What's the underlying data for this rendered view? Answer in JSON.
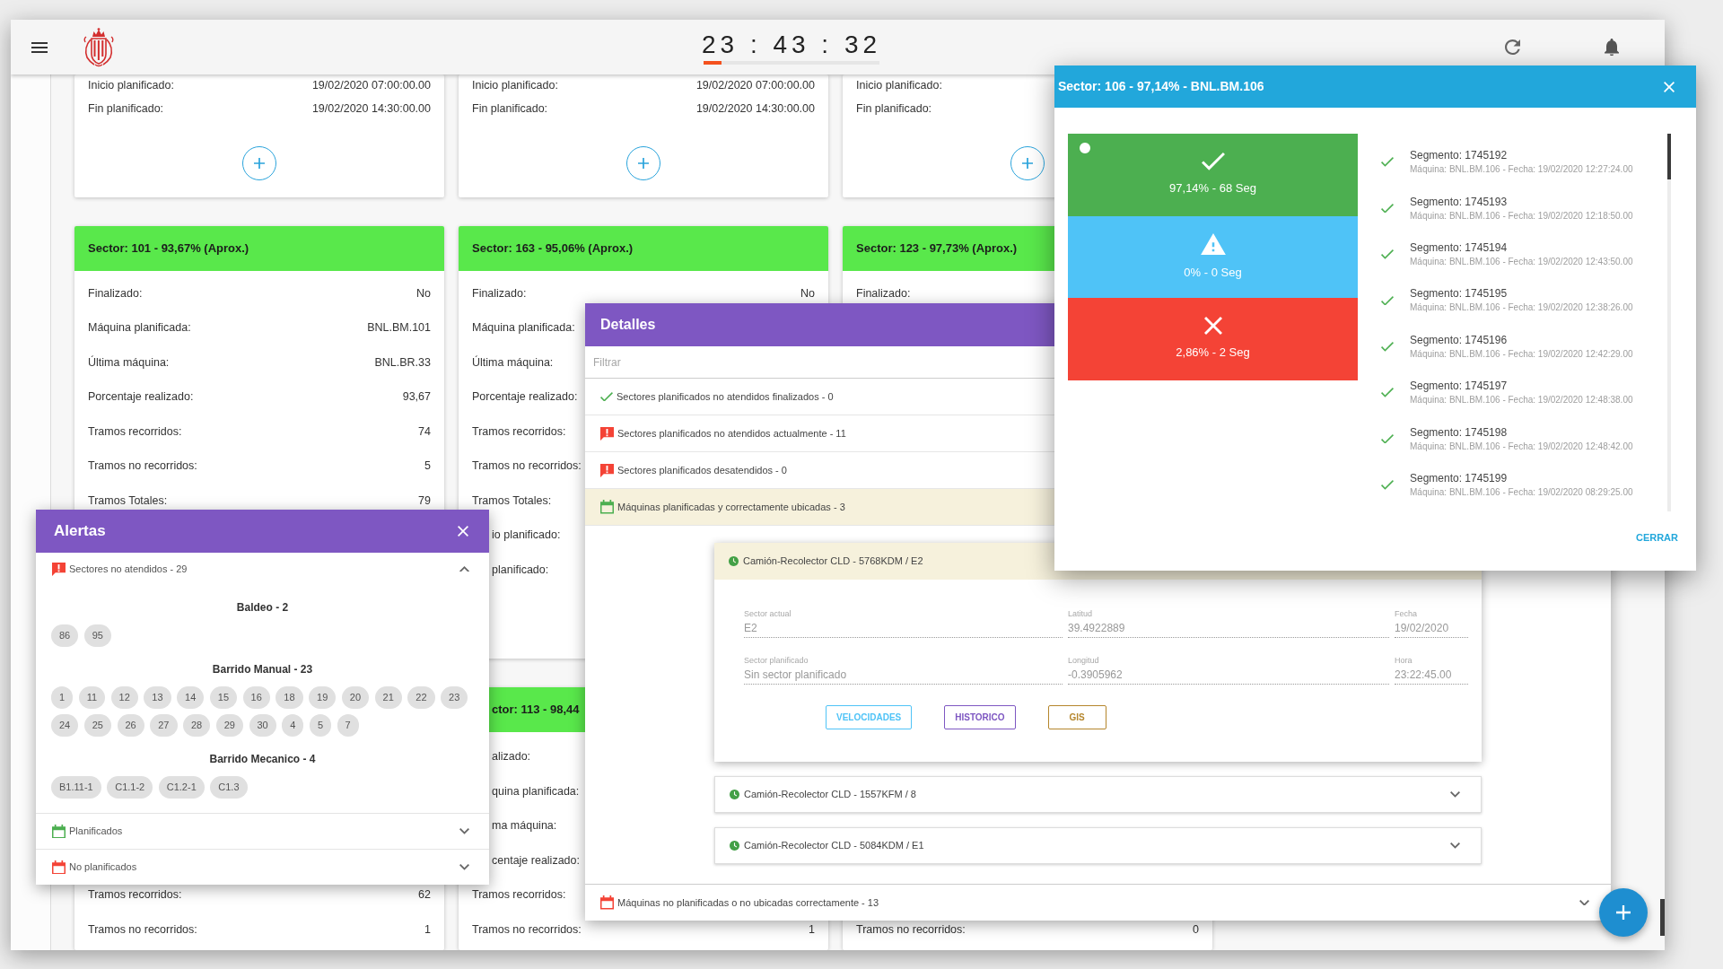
{
  "header": {
    "time": "23 : 43 : 32",
    "level": 0.1
  },
  "card_rows": [
    [
      {
        "add_button": true,
        "fields": [
          {
            "label": "Inicio planificado:",
            "value": "19/02/2020 07:00:00.00"
          },
          {
            "label": "Fin planificado:",
            "value": "19/02/2020 14:30:00.00"
          }
        ]
      },
      {
        "add_button": true,
        "fields": [
          {
            "label": "Inicio planificado:",
            "value": "19/02/2020 07:00:00.00"
          },
          {
            "label": "Fin planificado:",
            "value": "19/02/2020 14:30:00.00"
          }
        ]
      },
      {
        "add_button": true,
        "fields": [
          {
            "label": "Inicio planificado:"
          },
          {
            "label": "Fin planificado:"
          }
        ]
      }
    ],
    [
      {
        "title": "Sector: 101 - 93,67% (Aprox.)",
        "fields": [
          {
            "label": "Finalizado:",
            "value": "No"
          },
          {
            "label": "Máquina planificada:",
            "value": "BNL.BM.101"
          },
          {
            "label": "Última máquina:",
            "value": "BNL.BR.33"
          },
          {
            "label": "Porcentaje realizado:",
            "value": "93,67"
          },
          {
            "label": "Tramos recorridos:",
            "value": "74"
          },
          {
            "label": "Tramos no recorridos:",
            "value": "5"
          },
          {
            "label": "Tramos Totales:",
            "value": "79"
          }
        ]
      },
      {
        "title": "Sector: 163 - 95,06% (Aprox.)",
        "fields": [
          {
            "label": "Finalizado:",
            "value": "No"
          },
          {
            "label": "Máquina planificada:"
          },
          {
            "label": "Última máquina:"
          },
          {
            "label": "Porcentaje realizado:"
          },
          {
            "label": "Tramos recorridos:"
          },
          {
            "label": "Tramos no recorridos:"
          },
          {
            "label": "Tramos Totales:"
          },
          {
            "label": "io planificado:",
            "covered_left": true
          },
          {
            "label": "planificado:",
            "covered_left": true
          }
        ]
      },
      {
        "title": "Sector: 123 - 97,73% (Aprox.)",
        "fields": [
          {
            "label": "Finalizado:"
          }
        ]
      }
    ],
    [
      {
        "fields": [
          {
            "label": "Tramos recorridos:",
            "value": "62"
          },
          {
            "label": "Tramos no recorridos:",
            "value": "1"
          }
        ]
      },
      {
        "title": "ctor: 113 - 98,44",
        "title_covered_left": true,
        "fields": [
          {
            "label": "alizado:",
            "covered_left": true
          },
          {
            "label": "quina planificada:",
            "covered_left": true
          },
          {
            "label": "ma máquina:",
            "covered_left": true
          },
          {
            "label": "centaje realizado:",
            "covered_left": true
          },
          {
            "label": "Tramos recorridos:"
          },
          {
            "label": "Tramos no recorridos:",
            "value": "1"
          }
        ]
      },
      {
        "fields": [
          {
            "label": "Tramos no recorridos:",
            "value": "0"
          }
        ]
      }
    ]
  ],
  "alerts_panel": {
    "title": "Alertas",
    "sections": [
      {
        "kind": "alert",
        "color": "#f44336",
        "label": "Sectores no atendidos - 29",
        "expanded": true,
        "groups": [
          {
            "title": "Baldeo - 2",
            "chips": [
              "86",
              "95"
            ]
          },
          {
            "title": "Barrido Manual - 23",
            "chips": [
              "1",
              "11",
              "12",
              "13",
              "14",
              "15",
              "16",
              "18",
              "19",
              "20",
              "21",
              "22",
              "23",
              "24",
              "25",
              "26",
              "27",
              "28",
              "29",
              "30",
              "4",
              "5",
              "7"
            ]
          },
          {
            "title": "Barrido Mecanico - 4",
            "chips": [
              "B1.11-1",
              "C1.1-2",
              "C1.2-1",
              "C1.3"
            ]
          }
        ]
      },
      {
        "kind": "calendar",
        "color": "#4caf50",
        "label": "Planificados",
        "expanded": false
      },
      {
        "kind": "calendar",
        "color": "#f44336",
        "label": "No planificados",
        "expanded": false
      }
    ]
  },
  "details_panel": {
    "title": "Detalles",
    "filter": {
      "placeholder": "Filtrar"
    },
    "items": [
      {
        "kind": "check",
        "color": "#4caf50",
        "label": "Sectores planificados no atendidos finalizados - 0",
        "expanded": false
      },
      {
        "kind": "alert",
        "color": "#f44336",
        "label": "Sectores planificados no atendidos actualmente - 11",
        "expanded": false
      },
      {
        "kind": "alert",
        "color": "#f44336",
        "label": "Sectores planificados desatendidos - 0",
        "expanded": false
      },
      {
        "kind": "calendar",
        "color": "#4caf50",
        "label": "Máquinas planificadas y correctamente ubicadas - 3",
        "expanded": true,
        "machines": [
          {
            "label": "Camión-Recolector CLD - 5768KDM / E2",
            "expanded": true,
            "fields": [
              {
                "label": "Sector actual",
                "value": "E2",
                "disabled": true
              },
              {
                "label": "Latitud",
                "value": "39.4922889",
                "disabled": true
              },
              {
                "label": "Fecha",
                "value": "19/02/2020",
                "disabled": true
              },
              {
                "label": "Sector planificado",
                "value": "Sin sector planificado",
                "disabled": true
              },
              {
                "label": "Longitud",
                "value": "-0.3905962",
                "disabled": true
              },
              {
                "label": "Hora",
                "value": "23:22:45.00",
                "disabled": true
              }
            ],
            "buttons": [
              {
                "label": "VELOCIDADES",
                "color": "#4fc3f7"
              },
              {
                "label": "HISTORICO",
                "color": "#7e57c2"
              },
              {
                "label": "GIS",
                "color": "#b5862c"
              }
            ]
          },
          {
            "label": "Camión-Recolector CLD - 1557KFM / 8",
            "expanded": false
          },
          {
            "label": "Camión-Recolector CLD - 5084KDM / E1",
            "expanded": false
          }
        ]
      },
      {
        "kind": "calendar",
        "color": "#f44336",
        "label": "Máquinas no planificadas o no ubicadas correctamente - 13",
        "expanded": false
      }
    ]
  },
  "sector_dialog": {
    "title": "Sector: 106 - 97,14% - BNL.BM.106",
    "tiles": [
      {
        "kind": "ok",
        "label": "97,14% - 68 Seg",
        "selected": true
      },
      {
        "kind": "warning",
        "label": "0% - 0 Seg",
        "selected": false
      },
      {
        "kind": "error",
        "label": "2,86% - 2 Seg",
        "selected": false
      }
    ],
    "segments": [
      {
        "title": "Segmento: 1745192",
        "detail": "Máquina: BNL.BM.106 - Fecha: 19/02/2020 12:27:24.00"
      },
      {
        "title": "Segmento: 1745193",
        "detail": "Máquina: BNL.BM.106 - Fecha: 19/02/2020 12:18:50.00"
      },
      {
        "title": "Segmento: 1745194",
        "detail": "Máquina: BNL.BM.106 - Fecha: 19/02/2020 12:43:50.00"
      },
      {
        "title": "Segmento: 1745195",
        "detail": "Máquina: BNL.BM.106 - Fecha: 19/02/2020 12:38:26.00"
      },
      {
        "title": "Segmento: 1745196",
        "detail": "Máquina: BNL.BM.106 - Fecha: 19/02/2020 12:42:29.00"
      },
      {
        "title": "Segmento: 1745197",
        "detail": "Máquina: BNL.BM.106 - Fecha: 19/02/2020 12:48:38.00"
      },
      {
        "title": "Segmento: 1745198",
        "detail": "Máquina: BNL.BM.106 - Fecha: 19/02/2020 12:48:42.00"
      },
      {
        "title": "Segmento: 1745199",
        "detail": "Máquina: BNL.BM.106 - Fecha: 19/02/2020 08:29:25.00"
      }
    ],
    "close_label": "CERRAR"
  }
}
